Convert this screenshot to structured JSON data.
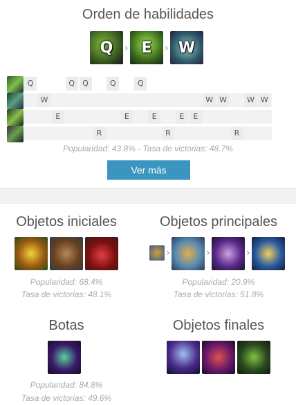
{
  "skill_order": {
    "title": "Orden de habilidades",
    "sequence": [
      "Q",
      "E",
      "W"
    ],
    "rows": [
      {
        "key": "Q",
        "levels": [
          1,
          4,
          5,
          7,
          9
        ]
      },
      {
        "key": "W",
        "levels": [
          2,
          14,
          15,
          17,
          18
        ]
      },
      {
        "key": "E",
        "levels": [
          3,
          8,
          10,
          12,
          13
        ]
      },
      {
        "key": "R",
        "levels": [
          6,
          11,
          16
        ]
      }
    ],
    "stats": "Popularidad: 43.8% - Tasa de victorias: 48.7%",
    "more_button": "Ver más"
  },
  "starting_items": {
    "title": "Objetos iniciales",
    "icons": [
      "seed-item-icon",
      "shield-item-icon",
      "potion-item-icon"
    ],
    "popularity": "Popularidad: 68.4%",
    "winrate": "Tasa de victorias: 48.1%"
  },
  "core_items": {
    "title": "Objetos principales",
    "icons": [
      "small-item-icon",
      "armored-gauntlet-icon",
      "purple-armor-icon",
      "hourglass-icon"
    ],
    "popularity": "Popularidad: 20.9%",
    "winrate": "Tasa de victorias: 51.8%"
  },
  "boots": {
    "title": "Botas",
    "icons": [
      "boots-icon"
    ],
    "popularity": "Popularidad: 84.8%",
    "winrate": "Tasa de victorias: 49.6%"
  },
  "final_items": {
    "title": "Objetos finales",
    "icons": [
      "staff-item-icon",
      "hat-item-icon",
      "thorns-item-icon"
    ]
  },
  "colors": {
    "accent": "#3a96c1",
    "stat_text": "#aaaaaa",
    "row_bg": "#f2f2f2"
  }
}
